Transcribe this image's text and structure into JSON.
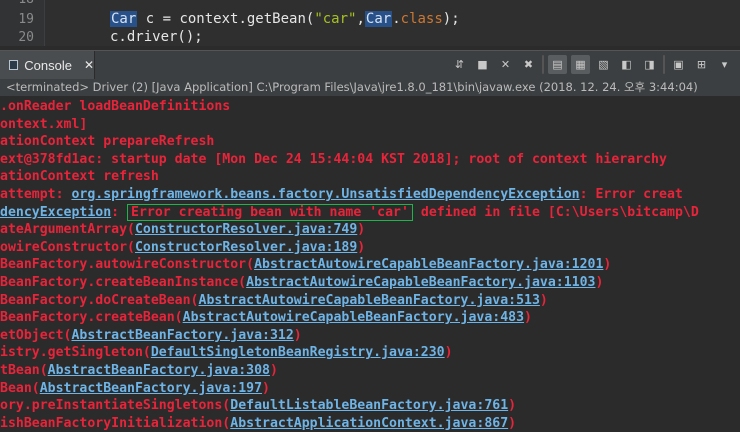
{
  "editor": {
    "line_numbers": [
      "18",
      "19",
      "20"
    ],
    "line19": {
      "type1": "Car",
      "mid": " c = context.getBean(",
      "str": "\"car\"",
      "comma": ",",
      "type2": "Car",
      "dot": ".",
      "cls": "class",
      "end": ");"
    },
    "line20": "c.driver();"
  },
  "console": {
    "tab_label": "Console",
    "tab_close": "✕",
    "toolbar_icons": [
      "pin-icon",
      "stop-icon",
      "remove-icon",
      "remove-all-icon",
      "clear-icon",
      "scroll-lock-icon",
      "word-wrap-icon",
      "show-on-output-icon",
      "show-on-error-icon",
      "pin-console-icon",
      "display-console-icon",
      "new-console-icon",
      "view-menu-icon"
    ],
    "terminated": "<terminated> Driver (2) [Java Application] C:\\Program Files\\Java\\jre1.8.0_181\\bin\\javaw.exe (2018. 12. 24. 오후 3:44:04)",
    "lines": [
      {
        "text": ".onReader loadBeanDefinitions"
      },
      {
        "text": "ontext.xml]"
      },
      {
        "text": "ationContext prepareRefresh"
      },
      {
        "text": "ext@378fd1ac: startup date [Mon Dec 24 15:44:04 KST 2018]; root of context hierarchy"
      },
      {
        "text": "ationContext refresh"
      },
      {
        "pre": " attempt: ",
        "link": "org.springframework.beans.factory.UnsatisfiedDependencyException",
        "post": ": Error creat"
      },
      {
        "link": "dencyException",
        "mid": ": ",
        "boxed": "Error creating bean with name 'car'",
        "post": " defined in file [C:\\Users\\bitcamp\\D"
      },
      {
        "pre": "ateArgumentArray(",
        "link": "ConstructorResolver.java:749",
        "post": ")"
      },
      {
        "pre": "owireConstructor(",
        "link": "ConstructorResolver.java:189",
        "post": ")"
      },
      {
        "pre": "BeanFactory.autowireConstructor(",
        "link": "AbstractAutowireCapableBeanFactory.java:1201",
        "post": ")"
      },
      {
        "pre": "BeanFactory.createBeanInstance(",
        "link": "AbstractAutowireCapableBeanFactory.java:1103",
        "post": ")"
      },
      {
        "pre": "BeanFactory.doCreateBean(",
        "link": "AbstractAutowireCapableBeanFactory.java:513",
        "post": ")"
      },
      {
        "pre": "BeanFactory.createBean(",
        "link": "AbstractAutowireCapableBeanFactory.java:483",
        "post": ")"
      },
      {
        "pre": "etObject(",
        "link": "AbstractBeanFactory.java:312",
        "post": ")"
      },
      {
        "pre": "istry.getSingleton(",
        "link": "DefaultSingletonBeanRegistry.java:230",
        "post": ")"
      },
      {
        "pre": "tBean(",
        "link": "AbstractBeanFactory.java:308",
        "post": ")"
      },
      {
        "pre": "Bean(",
        "link": "AbstractBeanFactory.java:197",
        "post": ")"
      },
      {
        "pre": "ory.preInstantiateSingletons(",
        "link": "DefaultListableBeanFactory.java:761",
        "post": ")"
      },
      {
        "pre": "ishBeanFactoryInitialization(",
        "link": "AbstractApplicationContext.java:867",
        "post": ")"
      }
    ]
  }
}
